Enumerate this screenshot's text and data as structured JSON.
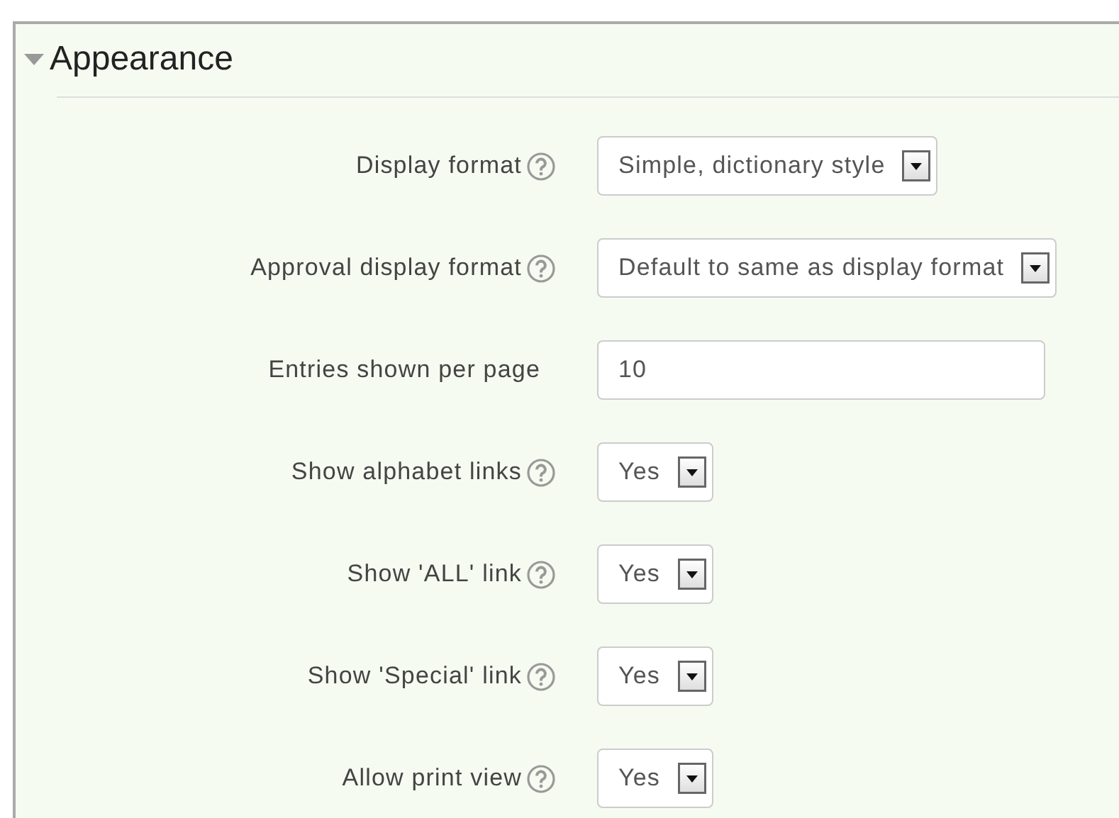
{
  "section": {
    "title": "Appearance",
    "expanded": true
  },
  "fields": [
    {
      "label": "Display format",
      "help": true,
      "kind": "select",
      "value": "Simple, dictionary style"
    },
    {
      "label": "Approval display format",
      "help": true,
      "kind": "select",
      "value": "Default to same as display format"
    },
    {
      "label": "Entries shown per page",
      "help": false,
      "kind": "text",
      "value": "10"
    },
    {
      "label": "Show alphabet links",
      "help": true,
      "kind": "select",
      "value": "Yes"
    },
    {
      "label": "Show 'ALL' link",
      "help": true,
      "kind": "select",
      "value": "Yes"
    },
    {
      "label": "Show 'Special' link",
      "help": true,
      "kind": "select",
      "value": "Yes"
    },
    {
      "label": "Allow print view",
      "help": true,
      "kind": "select",
      "value": "Yes"
    }
  ]
}
